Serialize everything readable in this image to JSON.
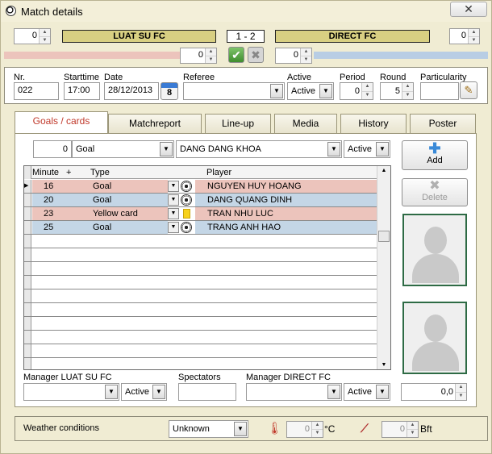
{
  "window": {
    "title": "Match details",
    "close": "✕"
  },
  "top": {
    "home_team": "LUAT SU FC",
    "away_team": "DIRECT FC",
    "score": "1 - 2",
    "home_field_value": "0",
    "away_field_value": "0",
    "home_sub_value": "0",
    "away_sub_value": "0"
  },
  "info": {
    "nr_label": "Nr.",
    "nr_value": "022",
    "starttime_label": "Starttime",
    "starttime_value": "17:00",
    "date_label": "Date",
    "date_value": "28/12/2013",
    "calendar_icon_text": "8",
    "referee_label": "Referee",
    "referee_value": "",
    "active_label": "Active",
    "active_value": "Active",
    "period_label": "Period",
    "period_value": "0",
    "round_label": "Round",
    "round_value": "5",
    "particularity_label": "Particularity",
    "particularity_value": ""
  },
  "tabs": [
    "Goals / cards",
    "Matchreport",
    "Line-up",
    "Media",
    "History",
    "Poster"
  ],
  "filter": {
    "minute_value": "0",
    "type_value": "Goal",
    "player_value": "DANG DANG KHOA",
    "status_value": "Active"
  },
  "grid": {
    "headers": {
      "minute": "Minute",
      "plus": "+",
      "type": "Type",
      "player": "Player"
    },
    "rows": [
      {
        "minute": "16",
        "type": "Goal",
        "player": "NGUYEN HUY HOANG",
        "side": "home",
        "icon": "ball"
      },
      {
        "minute": "20",
        "type": "Goal",
        "player": "DANG QUANG DINH",
        "side": "away",
        "icon": "ball"
      },
      {
        "minute": "23",
        "type": "Yellow card",
        "player": "TRAN NHU LUC",
        "side": "home",
        "icon": "yellow-card"
      },
      {
        "minute": "25",
        "type": "Goal",
        "player": "TRANG ANH HAO",
        "side": "away",
        "icon": "ball"
      }
    ],
    "empty_rows": 10
  },
  "buttons": {
    "add": "Add",
    "delete": "Delete"
  },
  "managers": {
    "home_label": "Manager LUAT SU FC",
    "home_value": "",
    "home_status": "Active",
    "spectators_label": "Spectators",
    "spectators_value": "",
    "away_label": "Manager DIRECT FC",
    "away_value": "",
    "away_status": "Active",
    "rating_value": "0,0"
  },
  "weather": {
    "label": "Weather conditions",
    "condition": "Unknown",
    "temp_value": "0",
    "temp_unit": "°C",
    "wind_value": "0",
    "wind_unit": "Bft"
  },
  "colors": {
    "home_row": "#ecc4bc",
    "away_row": "#c4d6e6",
    "team_band": "#d8cf82",
    "accent": "#c0392b",
    "home_bar": "#ecc4bc",
    "away_bar": "#b8cde4"
  }
}
